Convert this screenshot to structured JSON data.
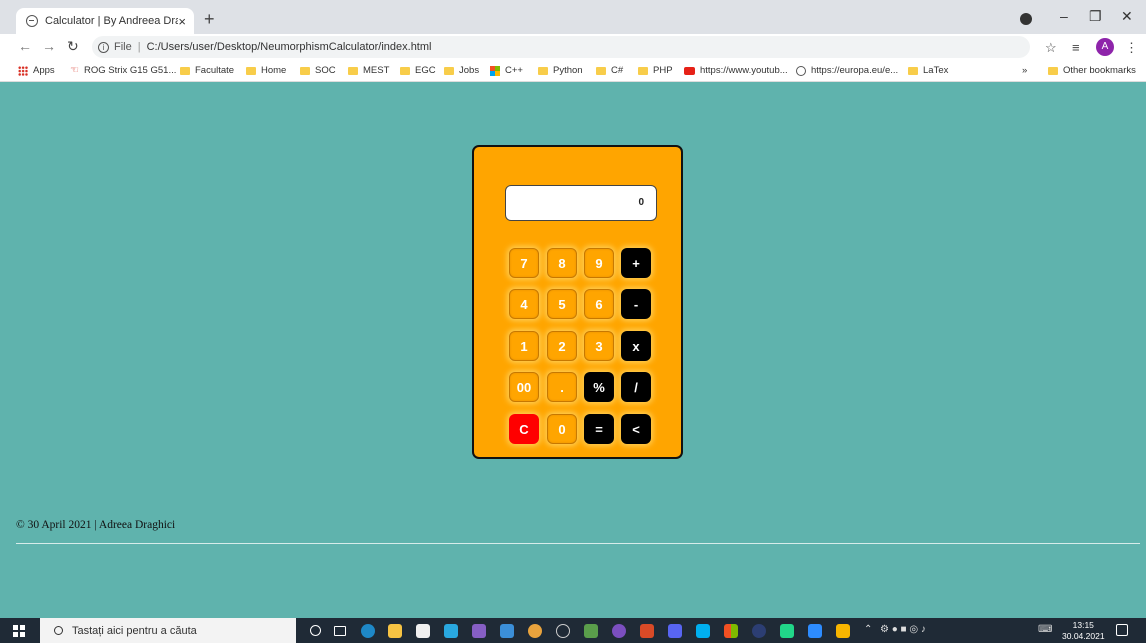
{
  "browser": {
    "tab_title": "Calculator | By Andreea Draghici",
    "tab_close": "×",
    "new_tab": "+",
    "address_scheme": "File",
    "address_path": "C:/Users/user/Desktop/NeumorphismCalculator/index.html",
    "avatar_letter": "A",
    "bookmarks": [
      {
        "label": "Apps",
        "icon": "apps-icon"
      },
      {
        "label": "ROG Strix G15 G51...",
        "icon": "rog-icon"
      },
      {
        "label": "Facultate",
        "icon": "folder-icon"
      },
      {
        "label": "Home",
        "icon": "folder-icon"
      },
      {
        "label": "SOC",
        "icon": "folder-icon"
      },
      {
        "label": "MEST",
        "icon": "folder-icon"
      },
      {
        "label": "EGC",
        "icon": "folder-icon"
      },
      {
        "label": "Jobs",
        "icon": "folder-icon"
      },
      {
        "label": "C++",
        "icon": "microsoft-icon"
      },
      {
        "label": "Python",
        "icon": "folder-icon"
      },
      {
        "label": "C#",
        "icon": "folder-icon"
      },
      {
        "label": "PHP",
        "icon": "folder-icon"
      },
      {
        "label": "https://www.youtub...",
        "icon": "youtube-icon"
      },
      {
        "label": "https://europa.eu/e...",
        "icon": "globe-icon"
      },
      {
        "label": "LaTex",
        "icon": "folder-icon"
      }
    ],
    "more_bookmarks": "»",
    "other_bookmarks": "Other bookmarks"
  },
  "calculator": {
    "display_value": "0",
    "keys": [
      [
        "7",
        "8",
        "9",
        "+"
      ],
      [
        "4",
        "5",
        "6",
        "-"
      ],
      [
        "1",
        "2",
        "3",
        "x"
      ],
      [
        "00",
        ".",
        "%",
        "/"
      ],
      [
        "C",
        "0",
        "=",
        "<"
      ]
    ],
    "colors": {
      "body": "#ffa500",
      "operator": "#000000",
      "clear": "#ff0000"
    }
  },
  "footer": {
    "text": "© 30 April 2021 | Adreea Draghici"
  },
  "taskbar": {
    "search_placeholder": "Tastați aici pentru a căuta",
    "time": "13:15",
    "date": "30.04.2021"
  }
}
